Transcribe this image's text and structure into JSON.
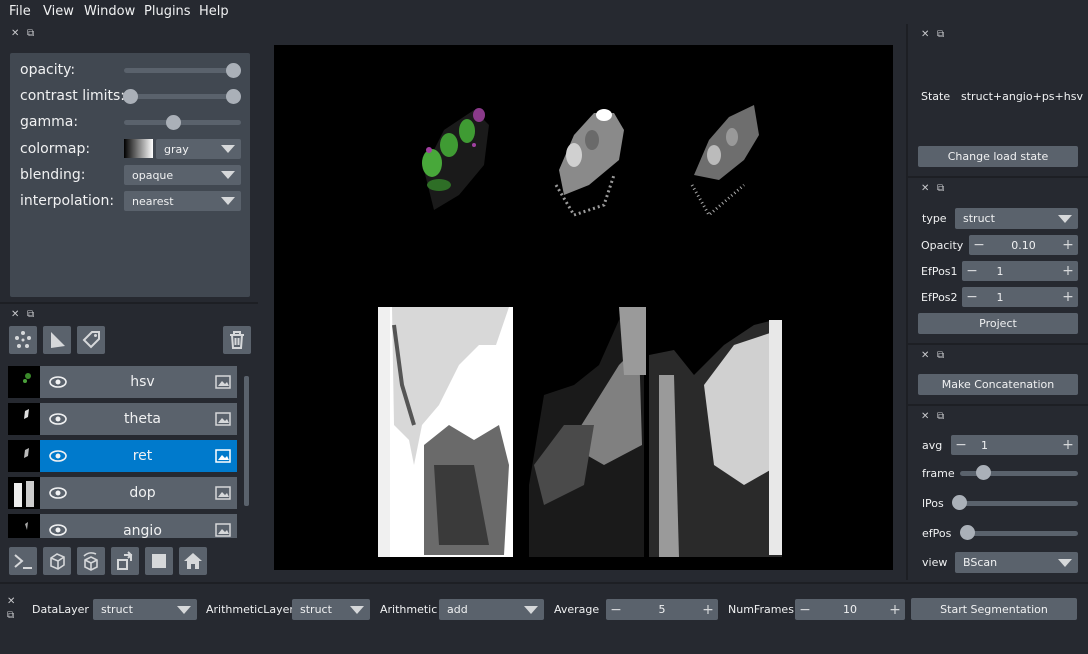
{
  "menu": [
    "File",
    "View",
    "Window",
    "Plugins",
    "Help"
  ],
  "layer_controls": {
    "opacity_label": "opacity:",
    "opacity_value": 1.0,
    "contrast_label": "contrast limits:",
    "contrast_range": [
      0.0,
      1.0
    ],
    "gamma_label": "gamma:",
    "gamma_value": 0.45,
    "colormap_label": "colormap:",
    "colormap_value": "gray",
    "blending_label": "blending:",
    "blending_value": "opaque",
    "interpolation_label": "interpolation:",
    "interpolation_value": "nearest"
  },
  "layers": [
    {
      "name": "hsv",
      "visible": true,
      "selected": false
    },
    {
      "name": "theta",
      "visible": true,
      "selected": false
    },
    {
      "name": "ret",
      "visible": true,
      "selected": true
    },
    {
      "name": "dop",
      "visible": true,
      "selected": false
    },
    {
      "name": "angio",
      "visible": true,
      "selected": false
    }
  ],
  "right_panel": {
    "state_label": "State",
    "state_value": "struct+angio+ps+hsv",
    "change_load_state": "Change load state",
    "type_label": "type",
    "type_value": "struct",
    "opacity_label": "Opacity",
    "opacity_value": "0.10",
    "efpos1_label": "EfPos1",
    "efpos1_value": "1",
    "efpos2_label": "EfPos2",
    "efpos2_value": "1",
    "project_button": "Project",
    "concat_button": "Make Concatenation",
    "avg_label": "avg",
    "avg_value": "1",
    "frame_label": "frame",
    "frame_value": 0.12,
    "lpos_label": "lPos",
    "lpos_value": 0.0,
    "efpos_label": "efPos",
    "efpos_value": 0.0,
    "view_label": "view",
    "view_value": "BScan"
  },
  "bottom_bar": {
    "datalayer_label": "DataLayer",
    "datalayer_value": "struct",
    "arithmeticlayer_label": "ArithmeticLayer",
    "arithmeticlayer_value": "struct",
    "arithmetic_label": "Arithmetic",
    "arithmetic_value": "add",
    "average_label": "Average",
    "average_value": "5",
    "numframes_label": "NumFrames",
    "numframes_value": "10",
    "start_button": "Start Segmentation"
  },
  "colors": {
    "background": "#262930",
    "panel": "#414851",
    "control": "#5a626c",
    "selected": "#007acc",
    "canvas": "#000000"
  }
}
